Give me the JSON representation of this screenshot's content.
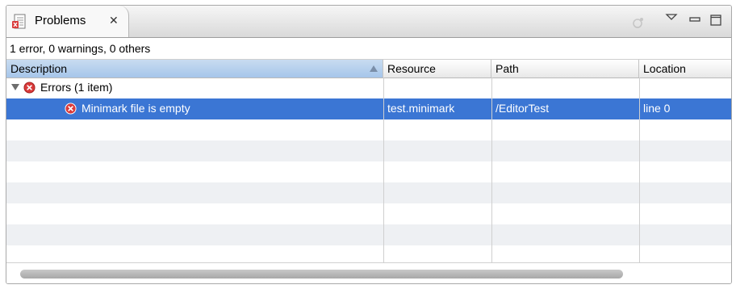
{
  "view": {
    "tab_title": "Problems",
    "tab_close_symbol": "✕",
    "summary": "1 error, 0 warnings, 0 others"
  },
  "table": {
    "columns": [
      "Description",
      "Resource",
      "Path",
      "Location"
    ],
    "group": {
      "label": "Errors (1 item)"
    },
    "rows": [
      {
        "description": "Minimark file is empty",
        "resource": "test.minimark",
        "path": "/EditorTest",
        "location": "line 0"
      }
    ]
  },
  "icons": {
    "tab": "problems-view-icon",
    "error": "error-icon",
    "menu": "view-menu-icon",
    "minimize": "minimize-icon",
    "maximize": "maximize-icon"
  },
  "colors": {
    "selection": "#3b76d4",
    "error": "#d93a3a",
    "sorted_header": "#a6c6ea"
  }
}
